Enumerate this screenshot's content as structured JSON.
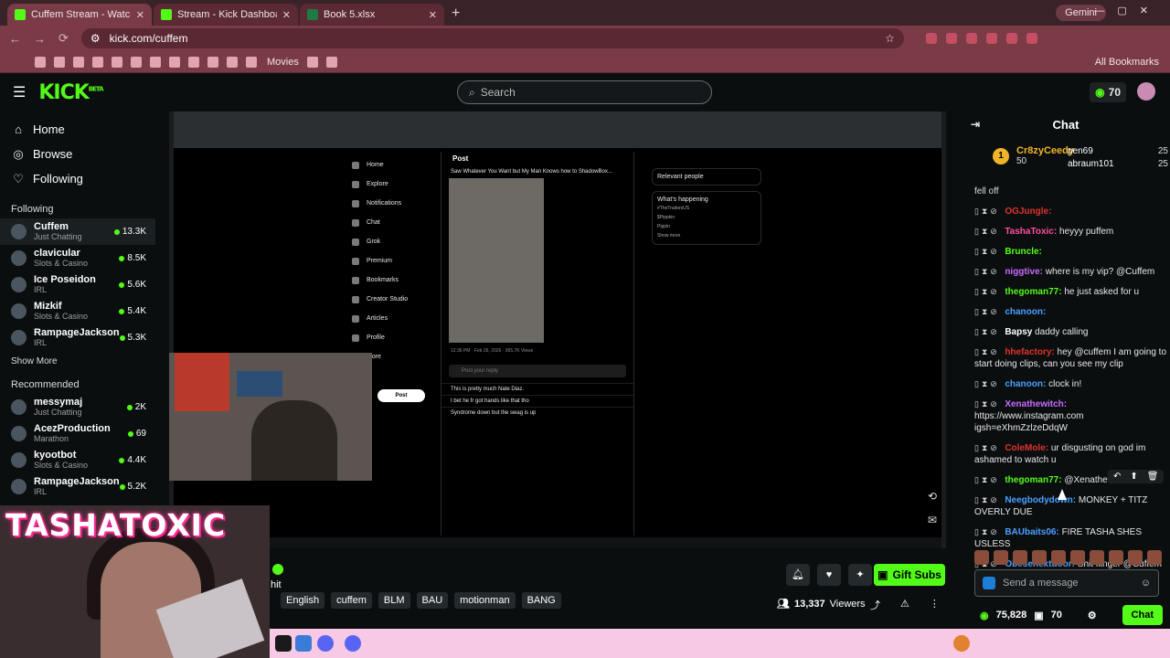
{
  "browser": {
    "tabs": [
      {
        "title": "Cuffem Stream - Watch Live",
        "active": true
      },
      {
        "title": "Stream - Kick Dashboard",
        "active": false
      },
      {
        "title": "Book 5.xlsx",
        "active": false
      }
    ],
    "gemini_label": "Gemini",
    "url": "kick.com/cuffem",
    "bookmarks": {
      "movies": "Movies",
      "all": "All Bookmarks"
    }
  },
  "kick_header": {
    "logo": "KICK",
    "logo_badge": "BETA",
    "search_placeholder": "Search",
    "kicks_count": "70"
  },
  "sidebar": {
    "nav": [
      {
        "label": "Home",
        "icon": "home-icon"
      },
      {
        "label": "Browse",
        "icon": "compass-icon"
      },
      {
        "label": "Following",
        "icon": "heart-icon"
      }
    ],
    "following_heading": "Following",
    "following": [
      {
        "name": "Cuffem",
        "category": "Just Chatting",
        "viewers": "13.3K"
      },
      {
        "name": "clavicular",
        "category": "Slots & Casino",
        "viewers": "8.5K"
      },
      {
        "name": "Ice Poseidon",
        "category": "IRL",
        "viewers": "5.6K"
      },
      {
        "name": "Mizkif",
        "category": "Slots & Casino",
        "viewers": "5.4K"
      },
      {
        "name": "RampageJackson",
        "category": "IRL",
        "viewers": "5.3K"
      }
    ],
    "show_more": "Show More",
    "recommended_heading": "Recommended",
    "recommended": [
      {
        "name": "messymaj",
        "category": "Just Chatting",
        "viewers": "2K"
      },
      {
        "name": "AcezProduction",
        "category": "Marathon",
        "viewers": "69"
      },
      {
        "name": "kyootbot",
        "category": "Slots & Casino",
        "viewers": "4.4K"
      },
      {
        "name": "RampageJackson",
        "category": "IRL",
        "viewers": "5.2K"
      }
    ]
  },
  "stream": {
    "inner_x": {
      "nav": [
        "Home",
        "Explore",
        "Notifications",
        "Chat",
        "Grok",
        "Premium",
        "Bookmarks",
        "Creator Studio",
        "Articles",
        "Profile",
        "More"
      ],
      "post_button": "Post",
      "post_header": "Post",
      "post_text": "Saw Whatever You Want but My Man Knows how to ShadowBox...",
      "post_meta": "12:36 PM · Feb 26, 2026 · 365.7K Views",
      "reply_placeholder": "Post your reply",
      "replies": [
        "This is pretty much Nate Diaz.",
        "I bet he fr got hands like that tho",
        "Syndrome down but the swag is up"
      ],
      "relevant_people": "Relevant people",
      "whats_happening": "What's happening",
      "trends": [
        "#TheTraitorsUS",
        "$Pippkin",
        "Pippin"
      ],
      "show_more": "Show more"
    },
    "overlay_name": "TASHATOXIC",
    "title_fragment": "hit",
    "tags": [
      "English",
      "cuffem",
      "BLM",
      "BAU",
      "motionman",
      "BANG"
    ],
    "gift_label": "Gift Subs",
    "viewers": "13,337",
    "viewers_label": "Viewers"
  },
  "chat": {
    "title": "Chat",
    "leaders": [
      {
        "name": "Cr8zyCeedy",
        "count": "50",
        "rank": "1"
      },
      {
        "name": "pen69",
        "count": "25"
      },
      {
        "name": "abraum101",
        "count": "25"
      }
    ],
    "messages": [
      {
        "user": "",
        "text": "fell off",
        "color": "#dddddd"
      },
      {
        "user": "OGJungle:",
        "text": "",
        "color": "#e0322f"
      },
      {
        "user": "TashaToxic:",
        "text": "heyyy puffem",
        "color": "#ff4fa3"
      },
      {
        "user": "Bruncle:",
        "text": "",
        "color": "#53fc18"
      },
      {
        "user": "niggtive:",
        "text": "where is my vip? @Cuffem",
        "color": "#c96bff"
      },
      {
        "user": "thegoman77:",
        "text": "he just asked for u",
        "color": "#53fc18"
      },
      {
        "user": "chanoon:",
        "text": "",
        "color": "#4aa0ff"
      },
      {
        "user": "Bapsy",
        "text": "daddy calling",
        "color": "#ffffff"
      },
      {
        "user": "hhefactory:",
        "text": "hey @cuffem I am going to start doing clips, can you see my clip",
        "color": "#e0322f"
      },
      {
        "user": "chanoon:",
        "text": "clock in!",
        "color": "#4aa0ff"
      },
      {
        "user": "Xenathewitch:",
        "text": "https://www.instagram.com igsh=eXhmZzlzeDdqW",
        "color": "#c96bff"
      },
      {
        "user": "ColeMole:",
        "text": "ur disgusting on god im ashamed to watch u",
        "color": "#e0322f"
      },
      {
        "user": "thegoman77:",
        "text": "@Xenathewitch LMAO",
        "color": "#53fc18"
      },
      {
        "user": "Neegbodydown:",
        "text": "MONKEY + TITZ OVERLY DUE",
        "color": "#4aa0ff"
      },
      {
        "user": "BAUbaits06:",
        "text": "FIRE TASHA SHES USLESS",
        "color": "#4aa0ff"
      },
      {
        "user": "Obesenextdoor:",
        "text": "Shit flinger @Cuffem",
        "color": "#4aa0ff"
      }
    ],
    "send_placeholder": "Send a message",
    "points": "75,828",
    "gifts": "70",
    "chat_button": "Chat"
  }
}
